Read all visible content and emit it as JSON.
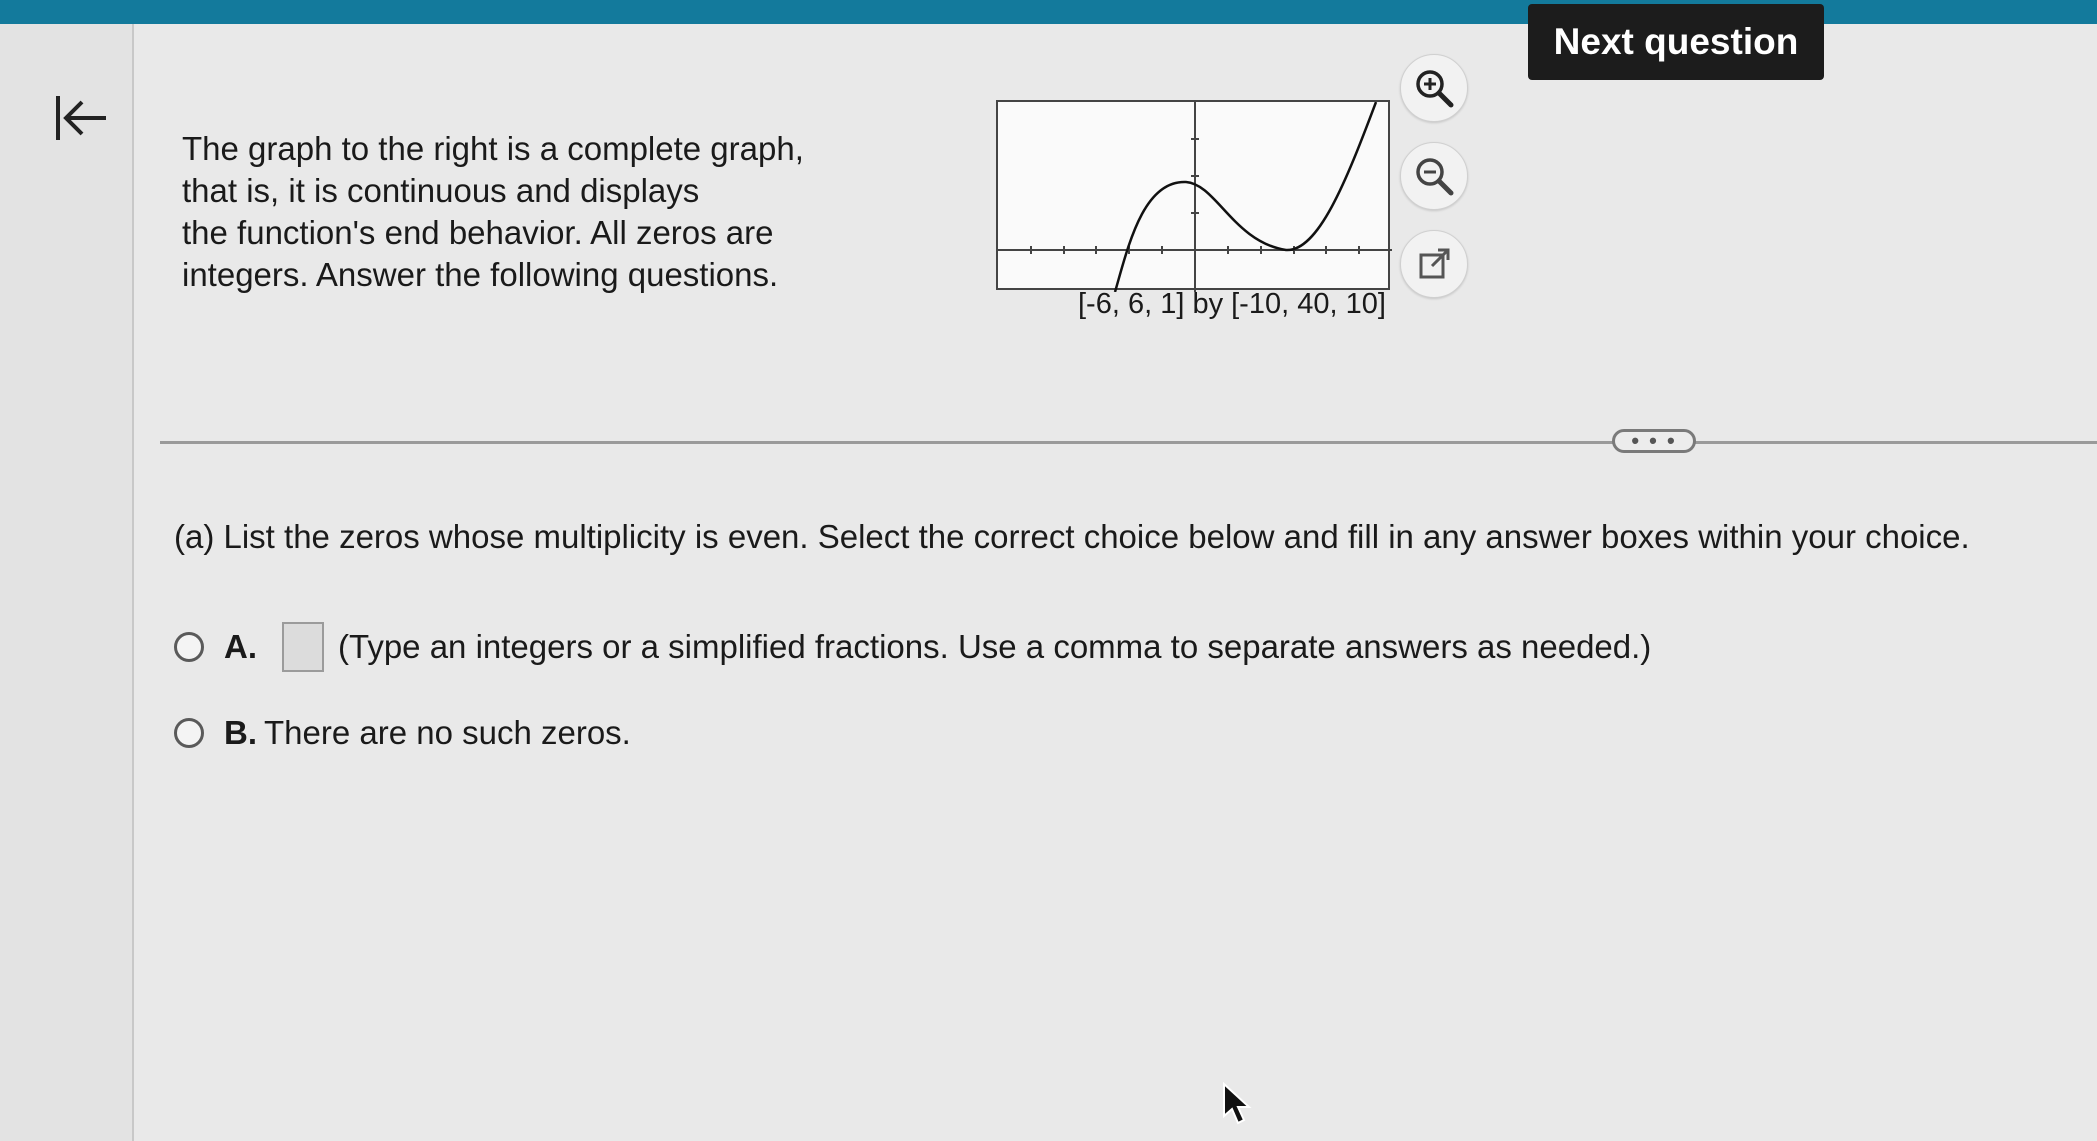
{
  "header": {
    "next_button_label": "Next question"
  },
  "intro": {
    "lines": [
      "The graph to the right is a complete graph,",
      "that is, it is continuous and displays",
      "the function's end behavior. All zeros are",
      "integers. Answer the following questions."
    ]
  },
  "graph": {
    "window_caption": "[-6, 6, 1] by [-10, 40, 10]",
    "tools": [
      "zoom-in-icon",
      "zoom-out-icon",
      "external-link-icon"
    ]
  },
  "divider": {
    "more_label": "• • •"
  },
  "question": {
    "part_a": "(a) List the zeros whose multiplicity is even. Select the correct choice below and fill in any answer boxes within your choice.",
    "choices": [
      {
        "letter": "A.",
        "has_input": true,
        "input_value": "",
        "text": "(Type an integers or a simplified fractions. Use a comma to separate answers as needed.)"
      },
      {
        "letter": "B.",
        "has_input": false,
        "text": "There are no such zeros."
      }
    ]
  },
  "colors": {
    "top_bar": "#137a9c",
    "next_button_bg": "#1c1c1c",
    "next_button_text": "#ffffff"
  }
}
